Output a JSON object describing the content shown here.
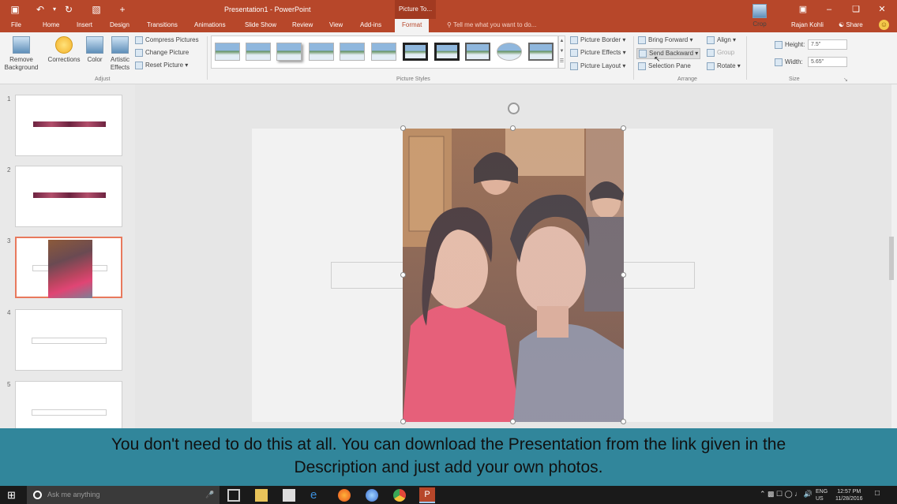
{
  "title_bar": {
    "quick_access": [
      "save-icon",
      "undo-icon",
      "redo-icon",
      "customize-icon"
    ],
    "window_title": "Presentation1 - PowerPoint",
    "context_tab_title": "Picture To...",
    "controls": [
      "ribbon-display-icon",
      "minimize-icon",
      "restore-icon",
      "close-icon"
    ]
  },
  "tabs": [
    "File",
    "Home",
    "Insert",
    "Design",
    "Transitions",
    "Animations",
    "Slide Show",
    "Review",
    "View",
    "Add-ins",
    "Format"
  ],
  "active_tab": "Format",
  "tell_me": "Tell me what you want to do...",
  "user_name": "Rajan Kohli",
  "share_label": "Share",
  "ribbon": {
    "adjust": {
      "remove_background": "Remove Background",
      "corrections": "Corrections",
      "color": "Color",
      "artistic_effects": "Artistic Effects",
      "compress": "Compress Pictures",
      "change": "Change Picture",
      "reset": "Reset Picture",
      "group_label": "Adjust"
    },
    "picture_styles_label": "Picture Styles",
    "picture_border": "Picture Border",
    "picture_effects": "Picture Effects",
    "picture_layout": "Picture Layout",
    "arrange": {
      "bring_forward": "Bring Forward",
      "send_backward": "Send Backward",
      "selection_pane": "Selection Pane",
      "align": "Align",
      "group": "Group",
      "rotate": "Rotate",
      "group_label": "Arrange"
    },
    "size": {
      "crop": "Crop",
      "height_label": "Height:",
      "height_value": "7.5\"",
      "width_label": "Width:",
      "width_value": "5.65\"",
      "group_label": "Size"
    }
  },
  "slides": [
    {
      "num": "1"
    },
    {
      "num": "2"
    },
    {
      "num": "3"
    },
    {
      "num": "4"
    },
    {
      "num": "5"
    }
  ],
  "caption": {
    "line1": "You don't need to do this at all. You can download the Presentation from the link given in the",
    "line2": "Description and just add your own photos."
  },
  "taskbar": {
    "search_placeholder": "Ask me anything",
    "language": "ENG",
    "region": "US",
    "time": "12:57 PM",
    "date": "11/28/2016"
  },
  "colors": {
    "accent": "#b7472a",
    "caption_bg": "#31869b",
    "selection": "#e8795d"
  }
}
